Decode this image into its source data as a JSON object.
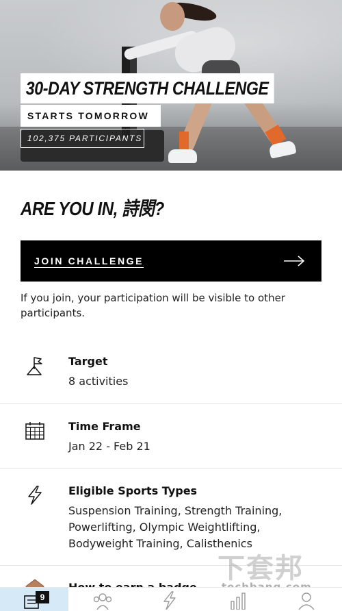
{
  "hero": {
    "title": "30-DAY STRENGTH CHALLENGE",
    "subtitle": "STARTS TOMORROW",
    "participants": "102,375 PARTICIPANTS"
  },
  "question": "ARE YOU IN, 詩閔?",
  "join_button": {
    "label": "JOIN CHALLENGE",
    "icon": "arrow-right-icon"
  },
  "visibility_note": "If you join, your participation will be visible to other participants.",
  "details": [
    {
      "label": "Target",
      "value": "8 activities",
      "icon": "flag-icon"
    },
    {
      "label": "Time Frame",
      "value": "Jan 22 - Feb 21",
      "icon": "calendar-icon"
    },
    {
      "label": "Eligible Sports Types",
      "value": "Suspension Training, Strength Training, Powerlifting, Olympic Weightlifting, Bodyweight Training, Calisthenics",
      "icon": "lightning-icon"
    },
    {
      "label": "How to earn a badge",
      "value": "",
      "icon": "badge-icon"
    }
  ],
  "bottom_nav": {
    "items": [
      {
        "name": "feed",
        "icon": "feed-icon",
        "badge": "9",
        "active": true
      },
      {
        "name": "community",
        "icon": "community-icon"
      },
      {
        "name": "activity",
        "icon": "lightning-icon"
      },
      {
        "name": "progress",
        "icon": "bar-chart-icon"
      },
      {
        "name": "profile",
        "icon": "profile-icon"
      }
    ]
  },
  "watermark": {
    "main": "下套邦",
    "sub": "techbang.com"
  },
  "colors": {
    "primary": "#000000",
    "active_tab": "#d6e9f7",
    "accent_orange": "#e0692b"
  }
}
